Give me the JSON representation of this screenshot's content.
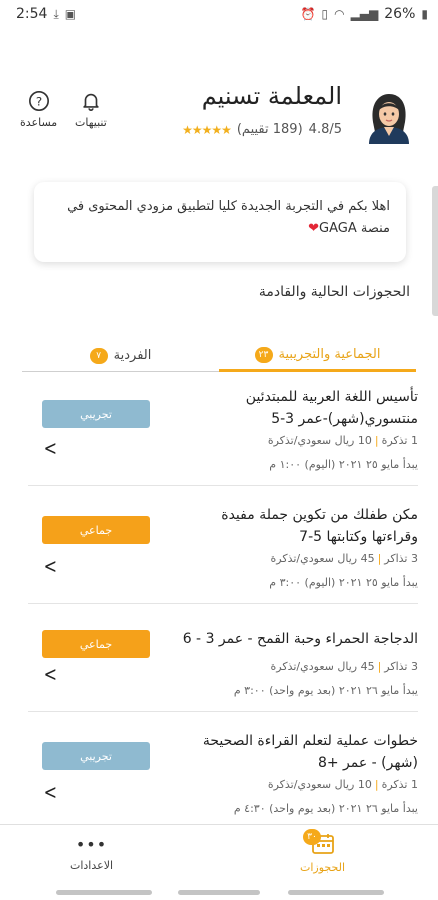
{
  "status_bar": {
    "time": "2:54",
    "battery": "26%"
  },
  "teacher": {
    "name": "المعلمة تسنيم",
    "rating_value": "4.8/5",
    "rating_count": "(189 تقييم)",
    "stars": "★★★★★"
  },
  "header_actions": {
    "help_label": "مساعدة",
    "notifications_label": "تنبيهات"
  },
  "welcome": {
    "text": "اهلا بكم في التجربة الجديدة كليا لتطبيق مزودي المحتوى في منصة GAGA",
    "heart": "❤"
  },
  "section_title": "الحجوزات الحالية والقادمة",
  "tabs": [
    {
      "label": "الجماعية والتجريبية",
      "badge": "٢٣",
      "active": true
    },
    {
      "label": "الفردية",
      "badge": "٧",
      "active": false
    }
  ],
  "bookings": [
    {
      "title": "تأسيس اللغة العربية للمبتدئين منتسوري(شهر)-عمر 3-5",
      "tickets": "1 تذكرة",
      "price": "10 ريال سعودي/تذكرة",
      "start": "يبدأ مايو ٢٥ ٢٠٢١ (اليوم) ١:٠٠ م",
      "type": "تجريبي",
      "kind": "trial"
    },
    {
      "title": "مكن طفلك من تكوين جملة مفيدة وقراءتها وكتابتها 5-7",
      "tickets": "3 تذاكر",
      "price": "45 ريال سعودي/تذكرة",
      "start": "يبدأ مايو ٢٥ ٢٠٢١ (اليوم) ٣:٠٠ م",
      "type": "جماعي",
      "kind": "group"
    },
    {
      "title": "الدجاجة الحمراء وحبة القمح - عمر 3 - 6",
      "tickets": "3 تذاكر",
      "price": "45 ريال سعودي/تذكرة",
      "start": "يبدأ مايو ٢٦ ٢٠٢١ (بعد يوم واحد) ٣:٠٠ م",
      "type": "جماعي",
      "kind": "group"
    },
    {
      "title": "خطوات عملية لتعلم القراءة الصحيحة (شهر) - عمر +8",
      "tickets": "1 تذكرة",
      "price": "10 ريال سعودي/تذكرة",
      "start": "يبدأ مايو ٢٦ ٢٠٢١ (بعد يوم واحد) ٤:٣٠ م",
      "type": "تجريبي",
      "kind": "trial"
    }
  ],
  "bottom_nav": {
    "settings_label": "الاعدادات",
    "settings_icon": "•••",
    "bookings_label": "الحجوزات",
    "bookings_badge": "٣٠"
  },
  "colors": {
    "accent": "#f5a91a",
    "trial_badge": "#8fbad0",
    "group_badge": "#f5a11a"
  }
}
